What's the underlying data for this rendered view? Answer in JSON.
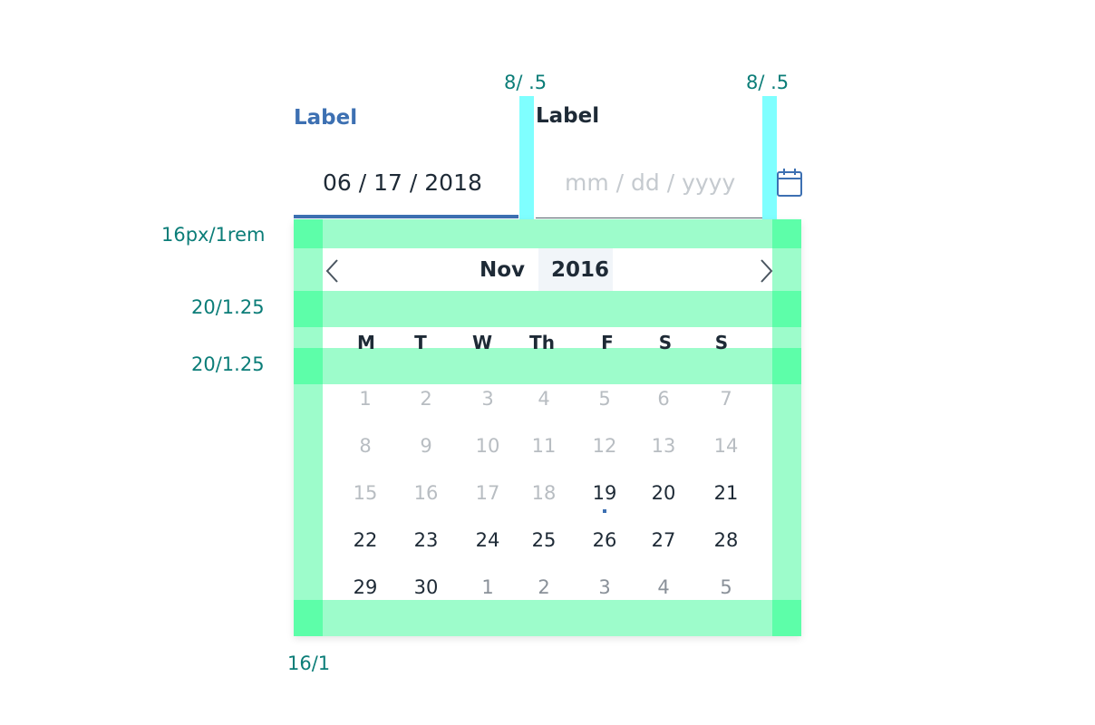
{
  "annotations": {
    "top_left": "8/ .5",
    "top_right": "8/ .5",
    "row1": "16px/1rem",
    "row2": "20/1.25",
    "row3": "20/1.25",
    "bottom": "16/1"
  },
  "date_from": {
    "label": "Label",
    "value": "06 / 17 / 2018",
    "label_color": "#3d70b2"
  },
  "date_to": {
    "label": "Label",
    "placeholder": "mm / dd / yyyy",
    "label_color": "#1e2a36"
  },
  "calendar_icon": "calendar-icon",
  "calendar": {
    "month": "Nov",
    "year": "2016",
    "weekdays": [
      "M",
      "T",
      "W",
      "Th",
      "F",
      "S",
      "S"
    ],
    "weeks": [
      [
        {
          "d": "1",
          "s": "muted"
        },
        {
          "d": "2",
          "s": "muted"
        },
        {
          "d": "3",
          "s": "muted"
        },
        {
          "d": "4",
          "s": "muted"
        },
        {
          "d": "5",
          "s": "muted"
        },
        {
          "d": "6",
          "s": "muted"
        },
        {
          "d": "7",
          "s": "muted"
        }
      ],
      [
        {
          "d": "8",
          "s": "muted"
        },
        {
          "d": "9",
          "s": "muted"
        },
        {
          "d": "10",
          "s": "muted"
        },
        {
          "d": "11",
          "s": "muted"
        },
        {
          "d": "12",
          "s": "muted"
        },
        {
          "d": "13",
          "s": "muted"
        },
        {
          "d": "14",
          "s": "muted"
        }
      ],
      [
        {
          "d": "15",
          "s": "muted"
        },
        {
          "d": "16",
          "s": "muted"
        },
        {
          "d": "17",
          "s": "muted"
        },
        {
          "d": "18",
          "s": "muted"
        },
        {
          "d": "19",
          "s": "today"
        },
        {
          "d": "20",
          "s": "active"
        },
        {
          "d": "21",
          "s": "active"
        }
      ],
      [
        {
          "d": "22",
          "s": "active"
        },
        {
          "d": "23",
          "s": "active"
        },
        {
          "d": "24",
          "s": "active"
        },
        {
          "d": "25",
          "s": "active"
        },
        {
          "d": "26",
          "s": "active"
        },
        {
          "d": "27",
          "s": "active"
        },
        {
          "d": "28",
          "s": "active"
        }
      ],
      [
        {
          "d": "29",
          "s": "active"
        },
        {
          "d": "30",
          "s": "active"
        },
        {
          "d": "1",
          "s": "next-month"
        },
        {
          "d": "2",
          "s": "next-month"
        },
        {
          "d": "3",
          "s": "next-month"
        },
        {
          "d": "4",
          "s": "next-month"
        },
        {
          "d": "5",
          "s": "next-month"
        }
      ]
    ]
  },
  "colors": {
    "accent": "#3d70b2",
    "text": "#1e2a36",
    "annotation": "#0b7d78",
    "spacing_cyan": "#7fffff",
    "spacing_green": "#9dfccb",
    "spacing_green_dark": "#5dfea9"
  }
}
